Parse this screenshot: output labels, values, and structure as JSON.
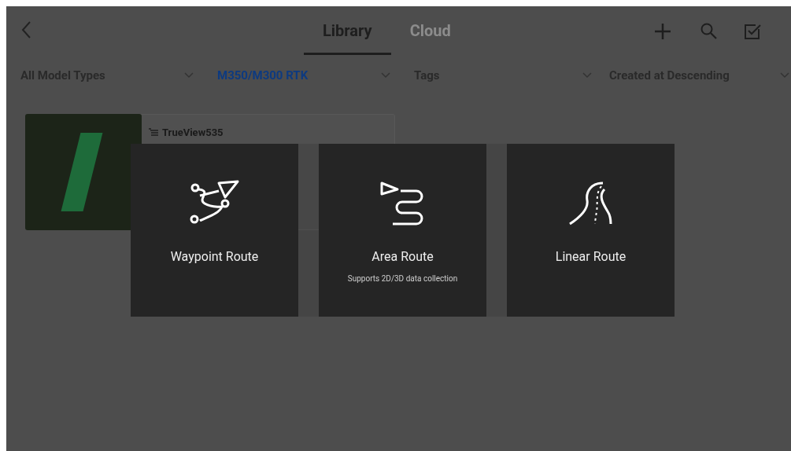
{
  "tabs": [
    {
      "label": "Library",
      "selected": true
    },
    {
      "label": "Cloud",
      "selected": false
    }
  ],
  "filters": [
    {
      "label": "All Model Types",
      "selected": false
    },
    {
      "label": "M350/M300 RTK",
      "selected": true
    },
    {
      "label": "Tags",
      "selected": false
    },
    {
      "label": "Created at Descending",
      "selected": false
    }
  ],
  "route_card": {
    "title": "TrueView535"
  },
  "route_types": [
    {
      "kind": "waypoint",
      "label": "Waypoint Route"
    },
    {
      "kind": "area",
      "label": "Area Route",
      "subtitle": "Supports 2D/3D data collection"
    },
    {
      "kind": "linear",
      "label": "Linear Route"
    }
  ]
}
